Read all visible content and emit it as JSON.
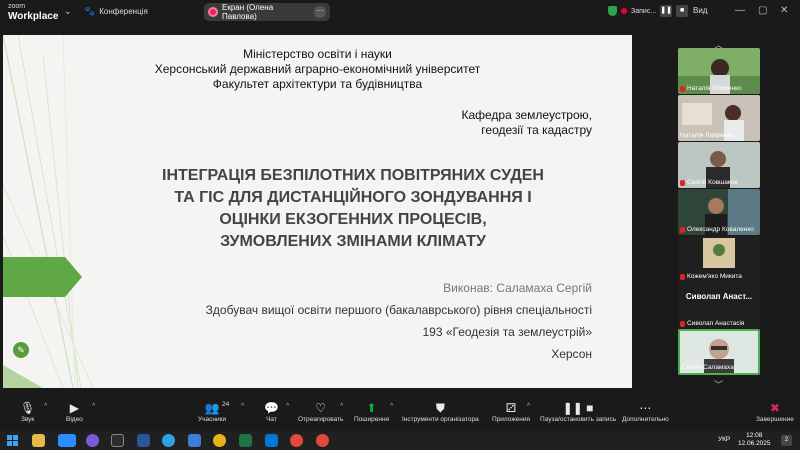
{
  "titlebar": {
    "logo_top": "zoom",
    "logo_bottom": "Workplace",
    "conference_label": "Конференція",
    "share_label": "Екран (Олена Павлова)",
    "recording_label": "Запис...",
    "view_label": "Вид"
  },
  "slide": {
    "header_lines": [
      "Міністерство освіти і науки",
      "Херсонський державний аграрно-економічний університет",
      "Факультет архітектури та будівництва"
    ],
    "department_lines": [
      "Кафедра землеустрою,",
      "геодезії та кадастру"
    ],
    "title_lines": [
      "ІНТЕГРАЦІЯ БЕЗПІЛОТНИХ ПОВІТРЯНИХ СУДЕН",
      "ТА ГІС ДЛЯ ДИСТАНЦІЙНОГО ЗОНДУВАННЯ І",
      "ОЦІНКИ ЕКЗОГЕННИХ ПРОЦЕСІВ,",
      "ЗУМОВЛЕНИХ ЗМІНАМИ КЛІМАТУ"
    ],
    "author": "Виконав: Саламаха Сергій",
    "degree": "Здобувач вищої освіти першого (бакалаврського) рівня спеціальності",
    "specialty": "193 «Геодезія та землеустрій»",
    "city": "Херсон"
  },
  "participants": [
    {
      "name": "Наталія Клименко"
    },
    {
      "name": "Наталія Лавренко"
    },
    {
      "name": "Сергій Ковшаков"
    },
    {
      "name": "Олександр Коваленко"
    },
    {
      "name": "Кожем'яко Микита"
    },
    {
      "name": "Сиволап Анастасія",
      "display": "Сиволап  Анаст..."
    },
    {
      "name": "Сергій Саламаха"
    }
  ],
  "toolbar": {
    "audio": "Звук",
    "video": "Відео",
    "participants": "Учасники",
    "participants_count": "24",
    "chat": "Чат",
    "react": "Отреагировать",
    "share": "Поширення",
    "host_tools": "Інструменти організатора",
    "apps": "Приложения",
    "pause_record": "Пауза/остановить запись",
    "more": "Дополнительно",
    "end": "Завершение"
  },
  "taskbar": {
    "language": "УКР",
    "time": "12:08",
    "date": "12.06.2025",
    "notifications": "2"
  },
  "colors": {
    "slide_green": "#5fa845",
    "record_red": "#e0245e",
    "share_green": "#00b34a",
    "active_border": "#4caf50"
  }
}
